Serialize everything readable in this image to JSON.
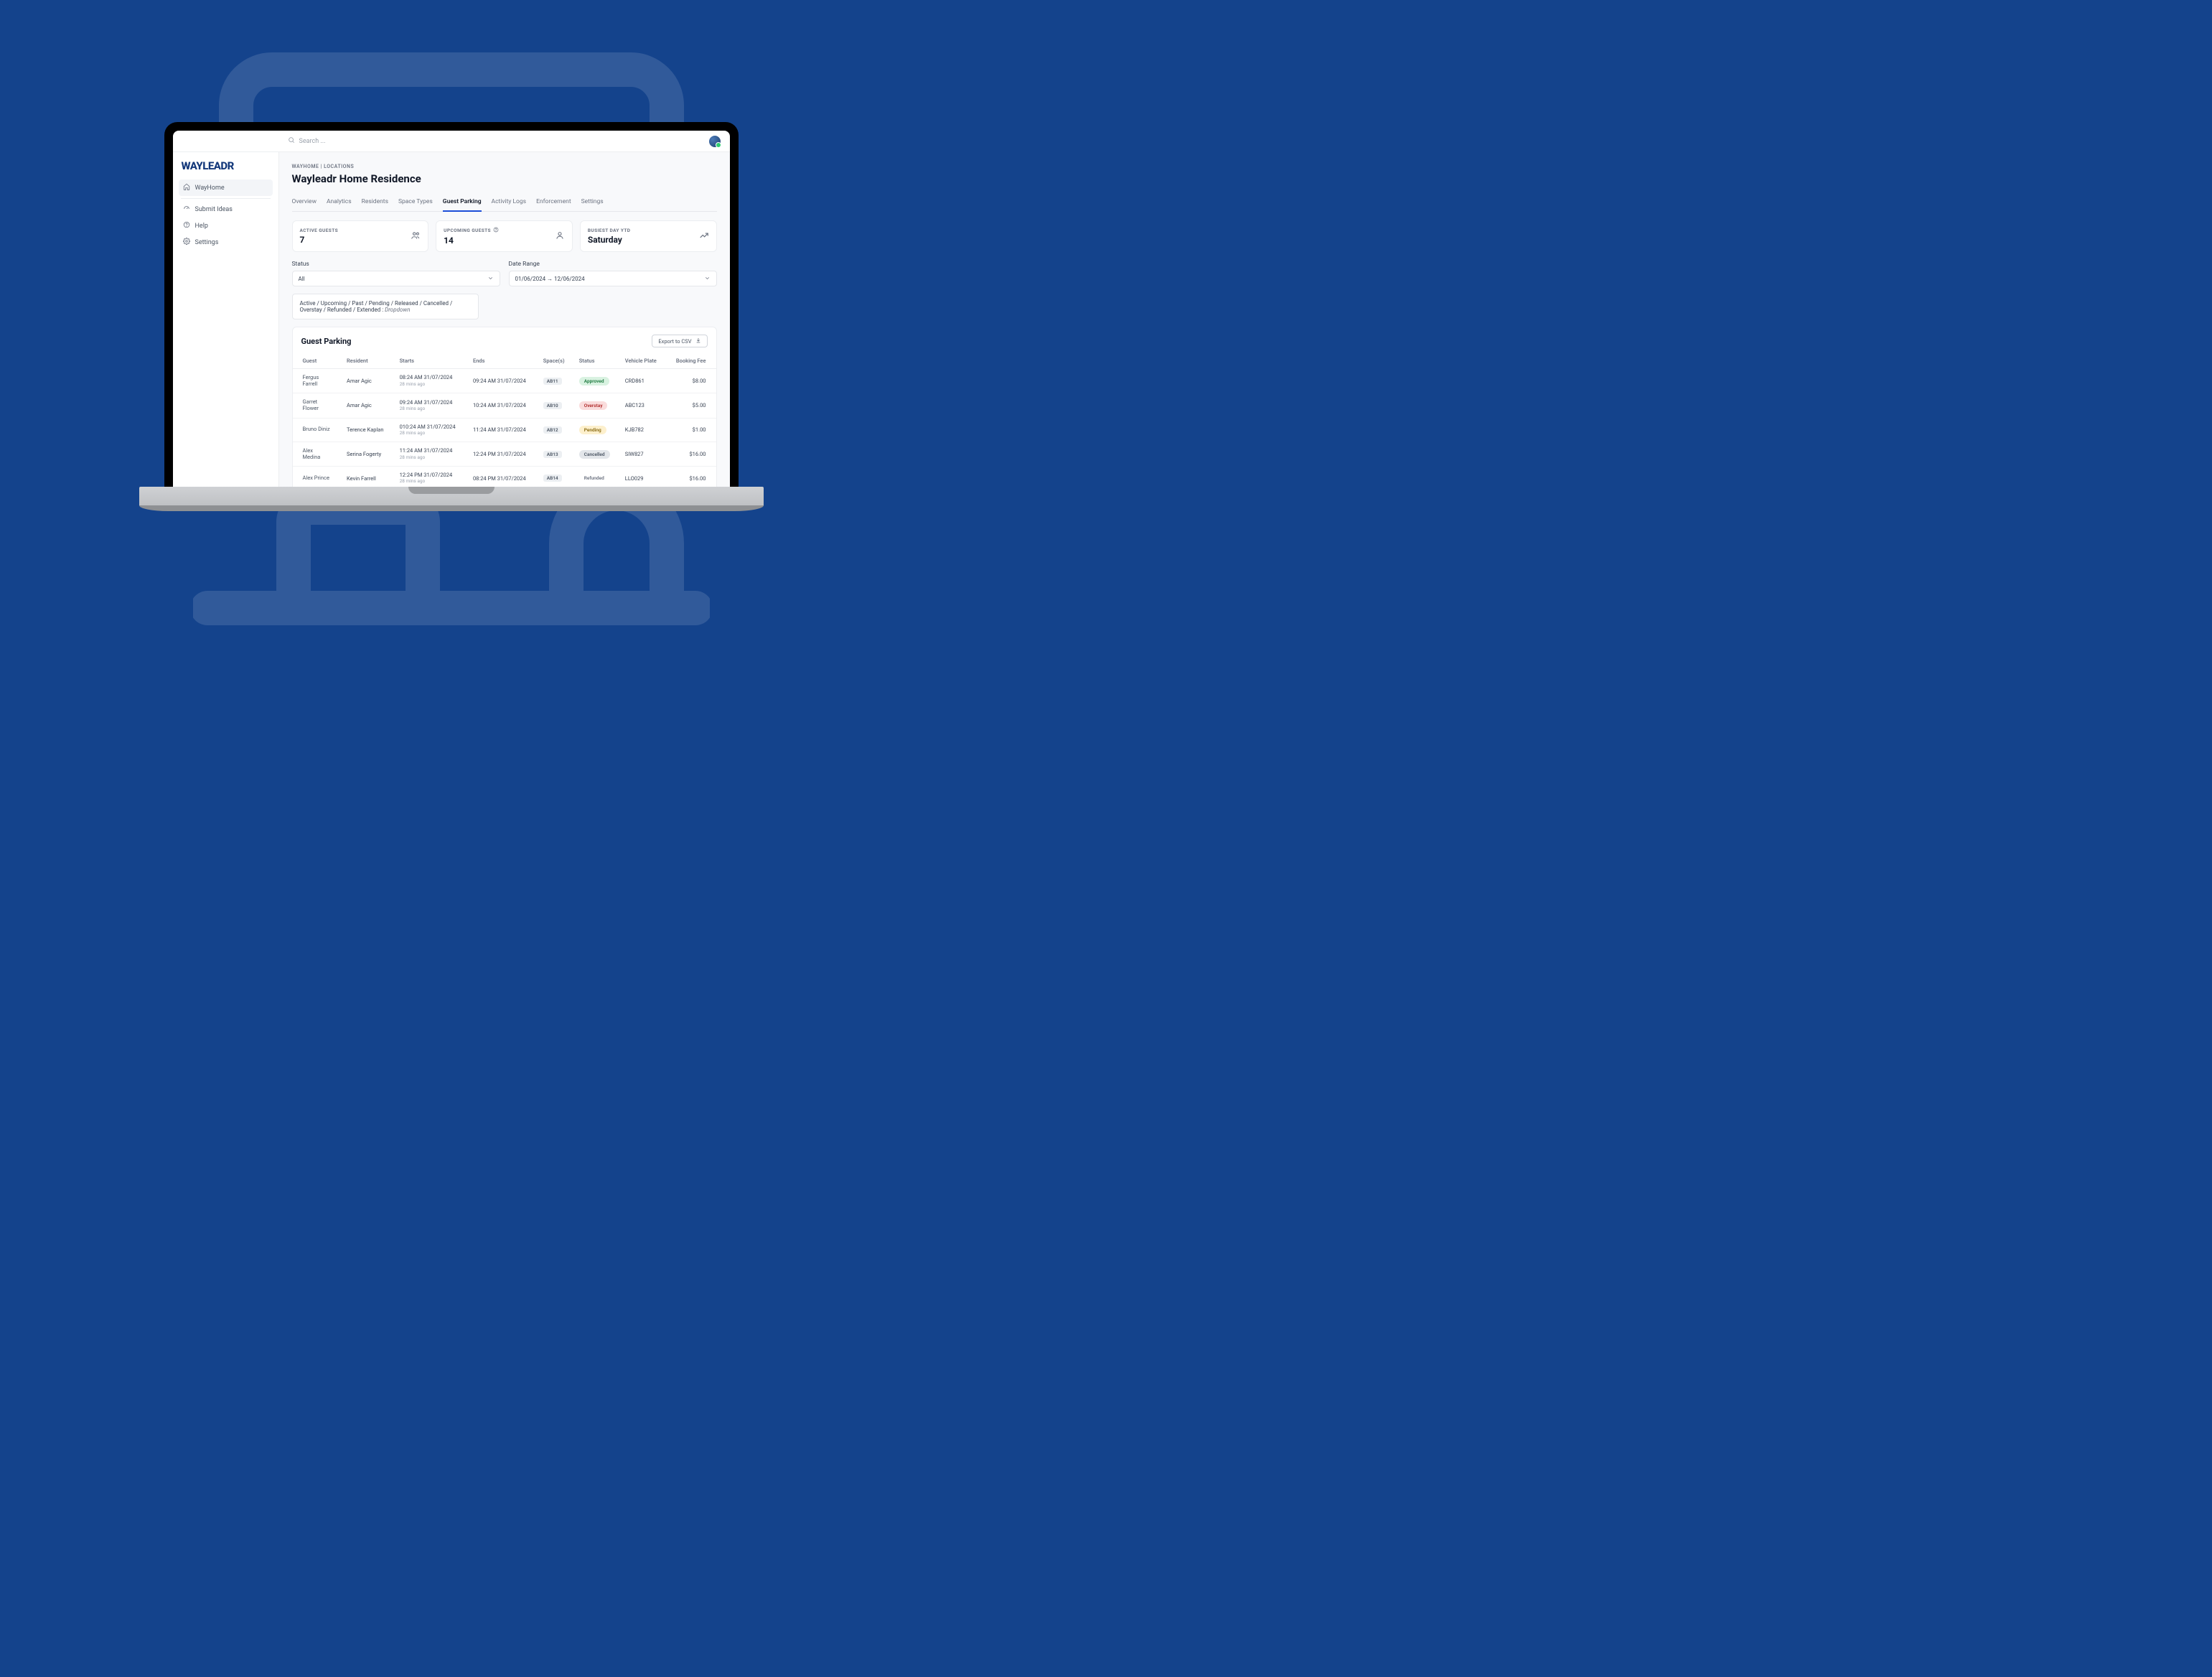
{
  "brand": "WAYLEADR",
  "search": {
    "placeholder": "Search ..."
  },
  "sidebar": {
    "items": [
      {
        "label": "WayHome",
        "icon": "home-icon"
      },
      {
        "label": "Submit Ideas",
        "icon": "speedometer-icon"
      },
      {
        "label": "Help",
        "icon": "help-icon"
      },
      {
        "label": "Settings",
        "icon": "gear-icon"
      }
    ]
  },
  "breadcrumb": "WAYHOME | LOCATIONS",
  "page_title": "Wayleadr Home Residence",
  "tabs": [
    "Overview",
    "Analytics",
    "Residents",
    "Space Types",
    "Guest Parking",
    "Activity Logs",
    "Enforcement",
    "Settings"
  ],
  "active_tab": "Guest Parking",
  "stats": {
    "active": {
      "label": "ACTIVE GUESTS",
      "value": "7"
    },
    "upcoming": {
      "label": "UPCOMING GUESTS",
      "value": "14"
    },
    "busiest": {
      "label": "BUSIEST DAY YTD",
      "value": "Saturday"
    }
  },
  "filters": {
    "status_label": "Status",
    "status_value": "All",
    "date_label": "Date Range",
    "date_value": "01/06/2024 → 12/06/2024",
    "hint_prefix": "Active / Upcoming / Past / Pending / Released / Cancelled / Overstay / Refunded / Extended : ",
    "hint_em": "Dropdown"
  },
  "table": {
    "title": "Guest Parking",
    "export_label": "Export to CSV",
    "columns": [
      "Guest",
      "Resident",
      "Starts",
      "Ends",
      "Space(s)",
      "Status",
      "Vehicle Plate",
      "Booking Fee"
    ],
    "rows": [
      {
        "guest": "Fergus Farrell",
        "resident": "Amar Agic",
        "starts": "08:24 AM 31/07/2024",
        "starts_sub": "28 mins ago",
        "ends": "09:24 AM 31/07/2024",
        "space": "AB11",
        "status": "Approved",
        "plate": "CRD861",
        "fee": "$8.00"
      },
      {
        "guest": "Garret Flower",
        "resident": "Amar Agic",
        "starts": "09:24 AM 31/07/2024",
        "starts_sub": "28 mins ago",
        "ends": "10:24 AM 31/07/2024",
        "space": "AB10",
        "status": "Overstay",
        "plate": "ABC123",
        "fee": "$5.00"
      },
      {
        "guest": "Bruno Diniz",
        "resident": "Terence Kaplan",
        "starts": "010:24 AM 31/07/2024",
        "starts_sub": "28 mins ago",
        "ends": "11:24 AM 31/07/2024",
        "space": "AB12",
        "status": "Pending",
        "plate": "KJB782",
        "fee": "$1.00"
      },
      {
        "guest": "Alex Medina",
        "resident": "Serina Fogerty",
        "starts": "11:24 AM 31/07/2024",
        "starts_sub": "28 mins ago",
        "ends": "12:24 PM 31/07/2024",
        "space": "AB13",
        "status": "Cancelled",
        "plate": "SIW827",
        "fee": "$16.00"
      },
      {
        "guest": "Alex Prince",
        "resident": "Kevin Farrell",
        "starts": "12:24 PM 31/07/2024",
        "starts_sub": "28 mins ago",
        "ends": "08:24 PM 31/07/2024",
        "space": "AB14",
        "status": "Refunded",
        "plate": "LLO029",
        "fee": "$16.00"
      }
    ]
  }
}
